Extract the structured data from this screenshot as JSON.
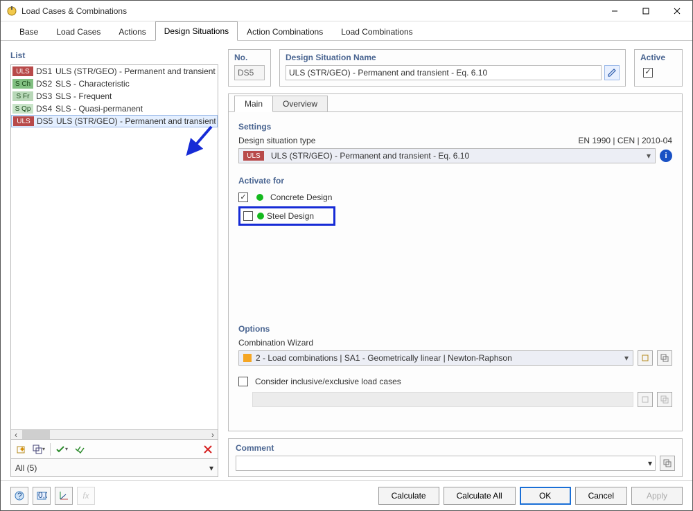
{
  "window": {
    "title": "Load Cases & Combinations"
  },
  "tabs": {
    "base": "Base",
    "load_cases": "Load Cases",
    "actions": "Actions",
    "design_situations": "Design Situations",
    "action_combinations": "Action Combinations",
    "load_combinations": "Load Combinations"
  },
  "list": {
    "label": "List",
    "rows": [
      {
        "tag": "ULS",
        "tagcls": "uls",
        "ds": "DS1",
        "name": "ULS (STR/GEO) - Permanent and transient - E"
      },
      {
        "tag": "S Ch",
        "tagcls": "sch",
        "ds": "DS2",
        "name": "SLS - Characteristic"
      },
      {
        "tag": "S Fr",
        "tagcls": "sfr",
        "ds": "DS3",
        "name": "SLS - Frequent"
      },
      {
        "tag": "S Qp",
        "tagcls": "sqp",
        "ds": "DS4",
        "name": "SLS - Quasi-permanent"
      },
      {
        "tag": "ULS",
        "tagcls": "uls",
        "ds": "DS5",
        "name": "ULS (STR/GEO) - Permanent and transient - E"
      }
    ],
    "filter": "All (5)"
  },
  "detail": {
    "no_label": "No.",
    "no_value": "DS5",
    "name_label": "Design Situation Name",
    "name_value": "ULS (STR/GEO) - Permanent and transient - Eq. 6.10",
    "active_label": "Active",
    "subtabs": {
      "main": "Main",
      "overview": "Overview"
    },
    "settings": {
      "title": "Settings",
      "dst_label": "Design situation type",
      "standard": "EN 1990 | CEN | 2010-04",
      "dst_tag": "ULS",
      "dst_value": "ULS (STR/GEO) - Permanent and transient - Eq. 6.10"
    },
    "activate": {
      "title": "Activate for",
      "concrete": "Concrete Design",
      "steel": "Steel Design"
    },
    "options": {
      "title": "Options",
      "cw_label": "Combination Wizard",
      "cw_value": "2 - Load combinations | SA1 - Geometrically linear | Newton-Raphson",
      "consider_label": "Consider inclusive/exclusive load cases"
    },
    "comment_label": "Comment"
  },
  "footer": {
    "calculate": "Calculate",
    "calculate_all": "Calculate All",
    "ok": "OK",
    "cancel": "Cancel",
    "apply": "Apply"
  }
}
